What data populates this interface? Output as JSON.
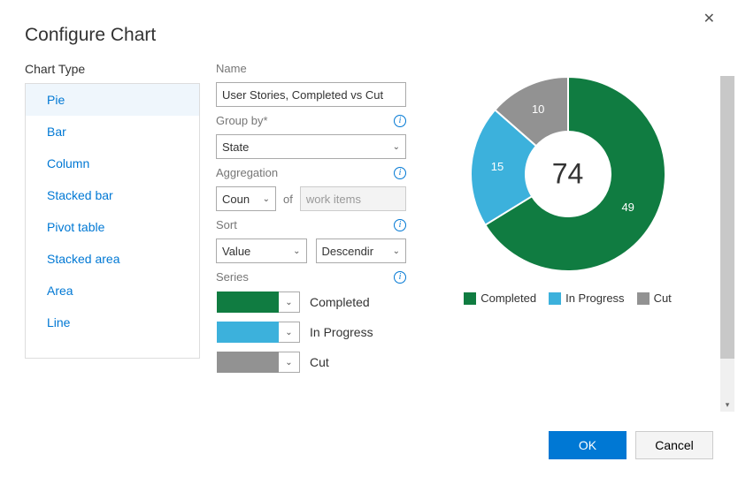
{
  "dialog": {
    "title": "Configure Chart",
    "ok": "OK",
    "cancel": "Cancel"
  },
  "chart_type": {
    "label": "Chart Type",
    "selected": "Pie",
    "items": [
      "Pie",
      "Bar",
      "Column",
      "Stacked bar",
      "Pivot table",
      "Stacked area",
      "Area",
      "Line"
    ]
  },
  "config": {
    "name_label": "Name",
    "name_value": "User Stories, Completed vs Cut",
    "groupby_label": "Group by*",
    "groupby_value": "State",
    "aggregation_label": "Aggregation",
    "aggregation_fn": "Coun",
    "aggregation_of": "of",
    "aggregation_unit": "work items",
    "sort_label": "Sort",
    "sort_field": "Value",
    "sort_dir": "Descendir",
    "series_label": "Series",
    "series": [
      {
        "color": "#107c41",
        "label": "Completed"
      },
      {
        "color": "#3cb1dc",
        "label": "In Progress"
      },
      {
        "color": "#929292",
        "label": "Cut"
      }
    ]
  },
  "chart_data": {
    "type": "pie",
    "title": "",
    "total": 74,
    "series": [
      {
        "name": "Completed",
        "value": 49,
        "color": "#107c41"
      },
      {
        "name": "In Progress",
        "value": 15,
        "color": "#3cb1dc"
      },
      {
        "name": "Cut",
        "value": 10,
        "color": "#929292"
      }
    ],
    "legend_position": "bottom"
  }
}
